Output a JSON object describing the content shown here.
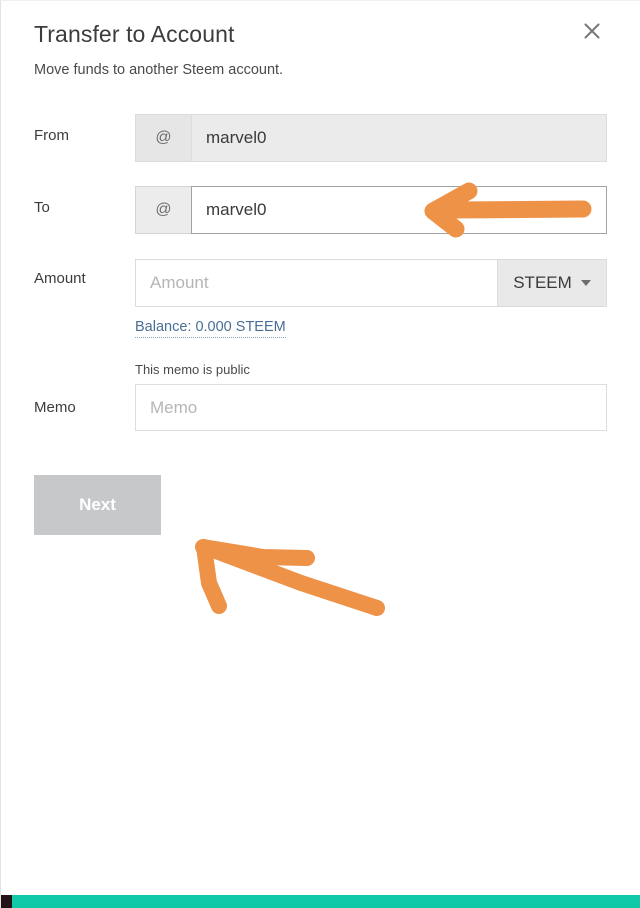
{
  "dialog": {
    "title": "Transfer to Account",
    "subtitle": "Move funds to another Steem account.",
    "close_label": "×"
  },
  "form": {
    "from": {
      "label": "From",
      "prefix": "@",
      "value": "marvel0"
    },
    "to": {
      "label": "To",
      "prefix": "@",
      "value": "marvel0"
    },
    "amount": {
      "label": "Amount",
      "placeholder": "Amount",
      "value": "",
      "asset": "STEEM",
      "balance_link": "Balance: 0.000 STEEM"
    },
    "memo": {
      "label": "Memo",
      "hint": "This memo is public",
      "placeholder": "Memo",
      "value": ""
    }
  },
  "actions": {
    "next_label": "Next"
  },
  "colors": {
    "annotation_orange": "#ee9248",
    "bottom_bar_teal": "#0fc8a8",
    "bottom_bar_tab": "#231218",
    "link_blue": "#4a6e94",
    "next_button_gray": "#c6c8ca"
  },
  "annotations": [
    {
      "name": "arrow-to-to-field",
      "color": "#ee9248",
      "points_at": "To field"
    },
    {
      "name": "arrow-to-next-button",
      "color": "#ee9248",
      "points_at": "Next button"
    }
  ]
}
